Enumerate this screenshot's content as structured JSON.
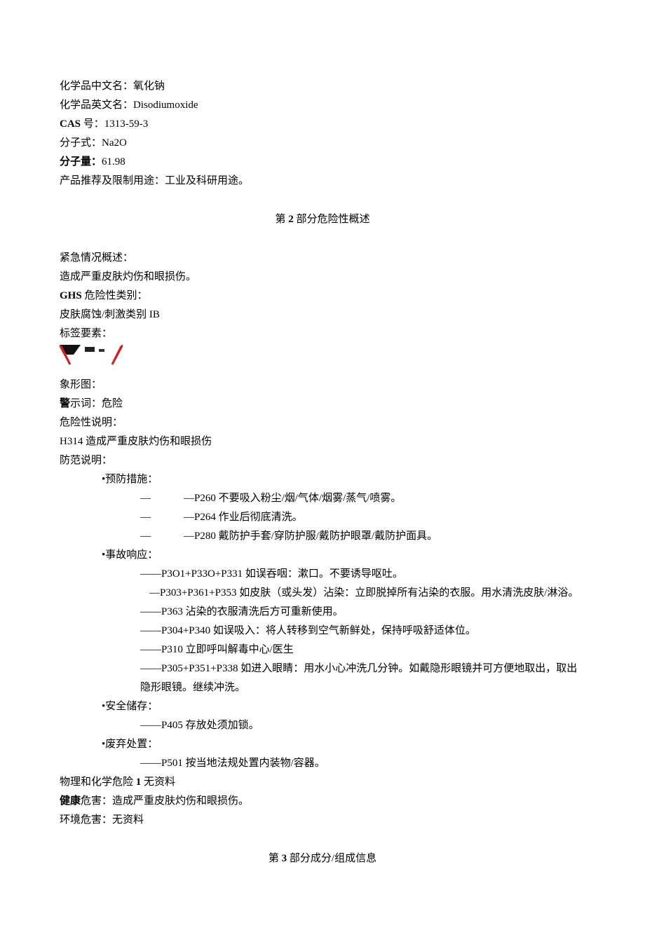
{
  "identity": {
    "cn_label": "化学品中文名：",
    "cn_value": "氧化钠",
    "en_label": "化学品英文名：",
    "en_value": "Disodiumoxide",
    "cas_label": "CAS",
    "cas_suffix": " 号：",
    "cas_value": "1313-59-3",
    "formula_label": "分子式：",
    "formula_value": "Na2O",
    "mw_label": "分子量：",
    "mw_value": "61.98",
    "use_label": "产品推荐及限制用途：",
    "use_value": "工业及科研用途。"
  },
  "section2": {
    "title_prefix": "第",
    "title_num": " 2 ",
    "title_suffix": "部分危险性概述",
    "emergency_label": "紧急情况概述：",
    "emergency_text": "造成严重皮肤灼伤和眼损伤。",
    "ghs_label": "GHS",
    "ghs_suffix": " 危险性类别：",
    "ghs_text": "皮肤腐蚀/刺激类别 IB",
    "label_elements": "标签要素：",
    "picto_label": "象形图：",
    "signal_bold": "警",
    "signal_rest": "示词：",
    "signal_value": "危险",
    "hazard_stmt_label": "危险性说明：",
    "hazard_stmt_text": "H314 造成严重皮肤灼伤和眼损伤",
    "precaution_label": "防范说明：",
    "prevention_header": "•预防措施：",
    "prevention": [
      {
        "dash1": "—",
        "dash2": "—P260 不要吸入粉尘/烟/气体/烟雾/蒸气/喷雾。"
      },
      {
        "dash1": "—",
        "dash2": "—P264 作业后彻底清洗。"
      },
      {
        "dash1": "—",
        "dash2": "—P280 戴防护手套/穿防护服/戴防护眼罩/戴防护面具。"
      }
    ],
    "response_header": "•事故响应：",
    "response": [
      "——P3O1+P33O+P331 如误吞咽：漱口。不要诱导呕吐。",
      "—P303+P361+P353 如皮肤（或头发）沾染：立即脱掉所有沾染的衣服。用水清洗皮肤/淋浴。",
      "——P363 沾染的衣服清洗后方可重新使用。",
      "——P304+P340 如误吸入：将人转移到空气新鲜处，保持呼吸舒适体位。",
      "——P310 立即呼叫解毒中心/医生",
      "——P305+P351+P338 如进入眼睛：用水小心冲洗几分钟。如戴隐形眼镜并可方便地取出，取出隐形眼镜。继续冲洗。"
    ],
    "storage_header": "•安全储存：",
    "storage": [
      "——P405 存放处须加锁。"
    ],
    "disposal_header": "•废弃处置：",
    "disposal": [
      "——P501 按当地法规处置内装物/容器。"
    ],
    "phys_chem_label1": "物理和化学危险",
    "phys_chem_label2": " 1 ",
    "phys_chem_value": "无资料",
    "health_bold": "健康",
    "health_rest": "危害：",
    "health_value": "造成严重皮肤灼伤和眼损伤。",
    "env_label": "环境危害：",
    "env_value": "无资料"
  },
  "section3": {
    "title_prefix": "第",
    "title_num": " 3 ",
    "title_suffix": "部分成分/组成信息"
  }
}
